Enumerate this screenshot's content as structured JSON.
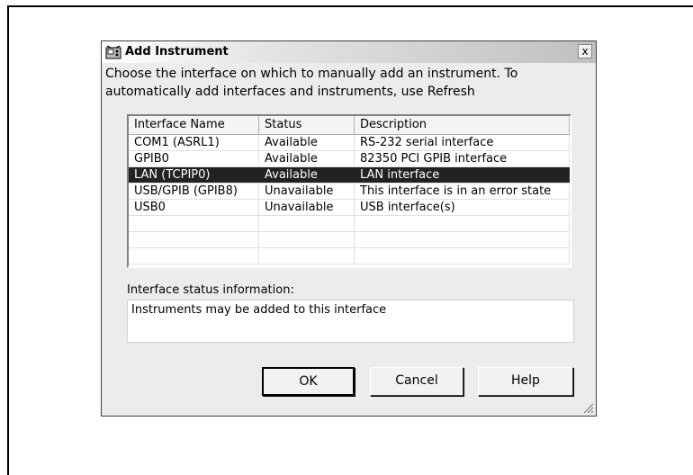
{
  "dialog": {
    "title": "Add Instrument",
    "close_glyph": "x",
    "instructions": "Choose the interface on which to manually add an instrument.  To automatically add interfaces and instruments, use Refresh"
  },
  "table": {
    "columns": [
      "Interface Name",
      "Status",
      "Description"
    ],
    "rows": [
      {
        "name": "COM1 (ASRL1)",
        "status": "Available",
        "description": "RS-232 serial interface"
      },
      {
        "name": "GPIB0",
        "status": "Available",
        "description": "82350 PCI GPIB interface"
      },
      {
        "name": "LAN (TCPIP0)",
        "status": "Available",
        "description": "LAN interface"
      },
      {
        "name": "USB/GPIB (GPIB8)",
        "status": "Unavailable",
        "description": "This interface is in an error state"
      },
      {
        "name": "USB0",
        "status": "Unavailable",
        "description": "USB interface(s)"
      }
    ],
    "selected_row_index": 2
  },
  "status_info": {
    "label": "Interface status information:",
    "text": "Instruments may be added to this interface"
  },
  "buttons": {
    "ok": "OK",
    "cancel": "Cancel",
    "help": "Help"
  },
  "colors": {
    "selected_row_bg": "#222222",
    "dialog_bg": "#ececec"
  }
}
